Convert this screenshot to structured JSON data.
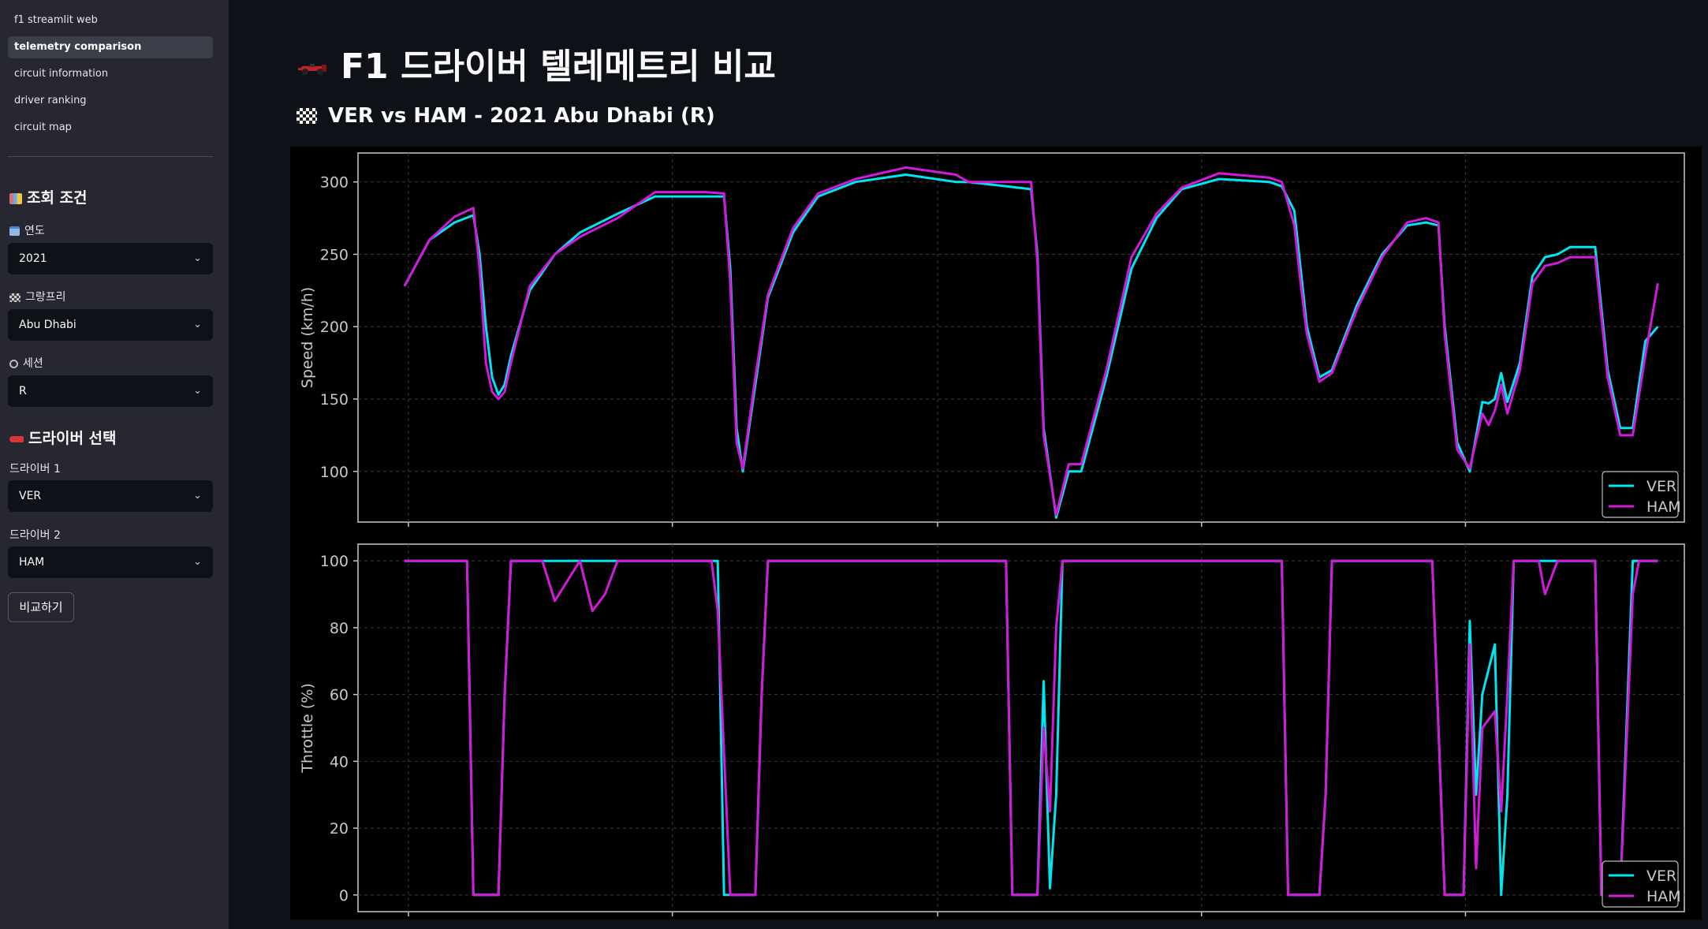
{
  "sidebar": {
    "nav": [
      {
        "label": "f1 streamlit web",
        "active": false
      },
      {
        "label": "telemetry comparison",
        "active": true
      },
      {
        "label": "circuit information",
        "active": false
      },
      {
        "label": "driver ranking",
        "active": false
      },
      {
        "label": "circuit map",
        "active": false
      }
    ],
    "query_title": "조회 조건",
    "year_label": "연도",
    "year_value": "2021",
    "gp_label": "그랑프리",
    "gp_value": "Abu Dhabi",
    "session_label": "세션",
    "session_value": "R",
    "driver_title": "드라이버 선택",
    "driver1_label": "드라이버 1",
    "driver1_value": "VER",
    "driver2_label": "드라이버 2",
    "driver2_value": "HAM",
    "compare_button": "비교하기"
  },
  "main": {
    "title": "F1 드라이버 텔레메트리 비교",
    "subtitle": "VER vs HAM - 2021 Abu Dhabi (R)"
  },
  "colors": {
    "ver": "#00e5ee",
    "ham": "#d21adb",
    "background": "#0e1117",
    "sidebar": "#262730"
  },
  "chart_data": [
    {
      "type": "line",
      "ylabel": "Speed (km/h)",
      "ylim": [
        65,
        320
      ],
      "yticks": [
        100,
        150,
        200,
        250,
        300
      ],
      "xlim": [
        0,
        100
      ],
      "grid": true,
      "legend": "bottom-right",
      "series": [
        {
          "name": "VER",
          "x": [
            0,
            2,
            4,
            5.5,
            6,
            6.5,
            7,
            7.5,
            8,
            8.5,
            10,
            12,
            14,
            17,
            20,
            24,
            25.5,
            26,
            26.5,
            27,
            28,
            29,
            31,
            33,
            36,
            40,
            44,
            45,
            50,
            50.5,
            51,
            52,
            53,
            54,
            56,
            58,
            60,
            62,
            65,
            69,
            70,
            71,
            71.5,
            72,
            73,
            74,
            76,
            78,
            80,
            81.5,
            82.5,
            83,
            84,
            85,
            86,
            86.5,
            87,
            87.5,
            88,
            89,
            90,
            91,
            92,
            93,
            95,
            96,
            97,
            98,
            99,
            100
          ],
          "y": [
            228,
            260,
            272,
            277,
            250,
            200,
            165,
            153,
            160,
            180,
            225,
            250,
            265,
            278,
            290,
            290,
            290,
            240,
            130,
            100,
            160,
            220,
            265,
            290,
            300,
            305,
            300,
            300,
            295,
            250,
            130,
            68,
            100,
            100,
            165,
            240,
            275,
            295,
            302,
            300,
            297,
            280,
            240,
            200,
            165,
            170,
            215,
            250,
            270,
            272,
            270,
            200,
            120,
            100,
            148,
            147,
            150,
            168,
            148,
            175,
            235,
            248,
            250,
            255,
            255,
            170,
            130,
            130,
            190,
            200
          ]
        },
        {
          "name": "HAM",
          "x": [
            0,
            2,
            4,
            5.5,
            6,
            6.5,
            7,
            7.5,
            8,
            8.5,
            10,
            12,
            14,
            17,
            20,
            24,
            25.5,
            26,
            26.5,
            27,
            28,
            29,
            31,
            33,
            36,
            40,
            44,
            45,
            50,
            50.5,
            51,
            52,
            53,
            54,
            56,
            58,
            60,
            62,
            65,
            69,
            70,
            71,
            71.5,
            72,
            73,
            74,
            76,
            78,
            80,
            81.5,
            82.5,
            83,
            84,
            85,
            86,
            86.5,
            87,
            87.5,
            88,
            89,
            90,
            91,
            92,
            93,
            95,
            96,
            97,
            98,
            99,
            100
          ],
          "y": [
            228,
            260,
            276,
            282,
            240,
            175,
            155,
            150,
            155,
            175,
            228,
            250,
            262,
            275,
            293,
            293,
            292,
            230,
            120,
            102,
            165,
            222,
            268,
            292,
            302,
            310,
            305,
            300,
            300,
            245,
            125,
            70,
            105,
            105,
            170,
            248,
            278,
            296,
            306,
            303,
            300,
            270,
            230,
            195,
            162,
            168,
            212,
            248,
            272,
            275,
            272,
            195,
            115,
            102,
            140,
            132,
            142,
            160,
            140,
            170,
            230,
            242,
            244,
            248,
            248,
            165,
            125,
            125,
            180,
            230
          ]
        }
      ]
    },
    {
      "type": "line",
      "ylabel": "Throttle (%)",
      "ylim": [
        -5,
        105
      ],
      "yticks": [
        0,
        20,
        40,
        60,
        80,
        100
      ],
      "xlim": [
        0,
        100
      ],
      "grid": true,
      "legend": "bottom-right",
      "series": [
        {
          "name": "VER",
          "x": [
            0,
            5,
            5.5,
            6,
            7.5,
            8,
            8.5,
            9,
            14,
            18,
            20,
            25,
            25.5,
            26,
            28,
            28.5,
            29,
            30,
            31,
            48,
            48.5,
            49,
            50.5,
            51,
            51.5,
            52,
            52.5,
            53,
            53.5,
            54,
            54.5,
            55,
            56,
            70,
            70.5,
            71,
            73,
            73.5,
            74,
            75,
            76,
            77,
            80,
            81.5,
            82,
            83,
            84,
            84.5,
            85,
            85.5,
            86,
            87,
            87.5,
            88,
            88.5,
            89,
            90,
            90.5,
            91,
            92,
            95,
            95.5,
            96,
            97,
            98,
            98.5,
            100
          ],
          "y": [
            100,
            100,
            0,
            0,
            0,
            60,
            100,
            100,
            100,
            100,
            100,
            100,
            0,
            0,
            0,
            60,
            100,
            100,
            100,
            100,
            0,
            0,
            0,
            64,
            2,
            30,
            100,
            100,
            100,
            100,
            100,
            100,
            100,
            100,
            0,
            0,
            0,
            30,
            100,
            100,
            100,
            100,
            100,
            100,
            100,
            0,
            0,
            0,
            82,
            30,
            60,
            75,
            0,
            30,
            100,
            100,
            100,
            100,
            100,
            100,
            100,
            0,
            0,
            0,
            100,
            100,
            100
          ]
        },
        {
          "name": "HAM",
          "x": [
            0,
            5,
            5.5,
            6,
            7.5,
            8,
            8.5,
            9,
            11,
            12,
            14,
            15,
            16,
            17,
            20,
            24.5,
            25,
            26,
            28,
            28.5,
            29,
            30,
            31,
            48,
            48.5,
            49,
            50.5,
            51,
            51.5,
            52,
            52.5,
            53,
            53.5,
            54,
            54.5,
            55,
            56,
            70,
            70.5,
            71,
            73,
            73.5,
            74,
            75,
            76,
            77,
            80,
            81.5,
            82,
            83,
            84,
            84.5,
            85,
            85.5,
            86,
            87,
            87.5,
            88,
            88.5,
            89,
            90,
            90.5,
            91,
            92,
            95,
            95.5,
            96,
            97,
            98,
            98.5,
            100
          ],
          "y": [
            100,
            100,
            0,
            0,
            0,
            60,
            100,
            100,
            100,
            88,
            100,
            85,
            90,
            100,
            100,
            100,
            85,
            0,
            0,
            60,
            100,
            100,
            100,
            100,
            0,
            0,
            0,
            50,
            25,
            80,
            100,
            100,
            100,
            100,
            100,
            100,
            100,
            100,
            0,
            0,
            0,
            30,
            100,
            100,
            100,
            100,
            100,
            100,
            100,
            0,
            0,
            0,
            75,
            8,
            50,
            55,
            25,
            60,
            100,
            100,
            100,
            100,
            90,
            100,
            100,
            0,
            0,
            0,
            90,
            100,
            100
          ]
        }
      ]
    }
  ]
}
